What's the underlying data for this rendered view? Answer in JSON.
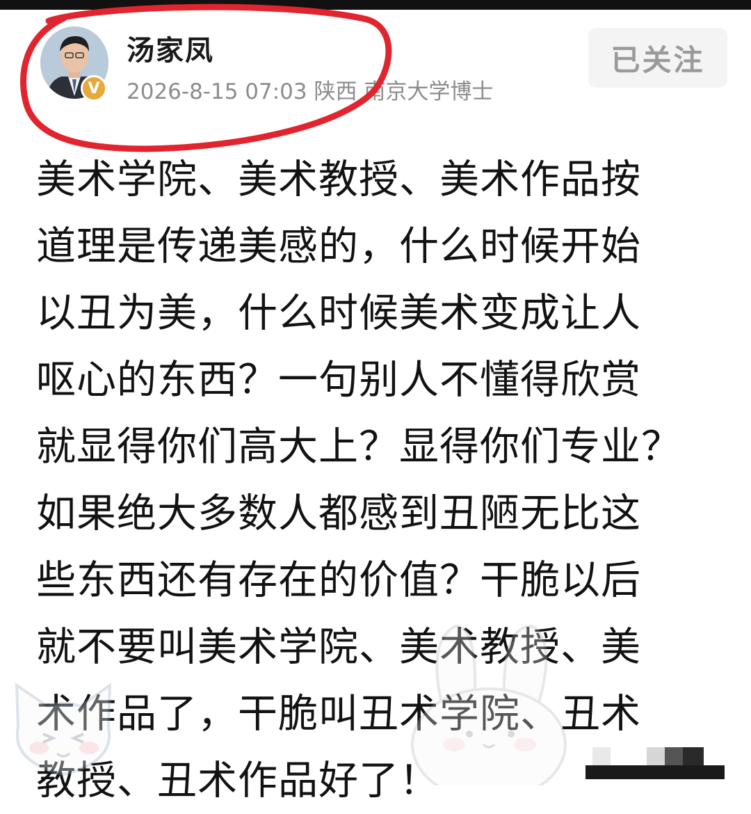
{
  "post": {
    "author": {
      "name": "汤家凤",
      "verified_badge": "V"
    },
    "meta": "2026-8-15 07:03 陕西 南京大学博士",
    "follow_label": "已关注",
    "body_lines": [
      "美术学院、美术教授、美术作品按",
      "道理是传递美感的，什么时候开始",
      "以丑为美，什么时候美术变成让人",
      "呕心的东西？一句别人不懂得欣赏",
      "就显得你们高大上？显得你们专业？",
      "如果绝大多数人都感到丑陋无比这",
      "些东西还有存在的价值？干脆以后",
      "就不要叫美术学院、美术教授、美",
      "术作品了，干脆叫丑术学院、丑术",
      "教授、丑术作品好了！"
    ]
  },
  "annotation_color": "#e0252f",
  "icons": [
    "avatar-photo",
    "verified-badge-icon",
    "red-highlight-circle",
    "cat-sticker-icon",
    "bunny-sticker-icon"
  ]
}
